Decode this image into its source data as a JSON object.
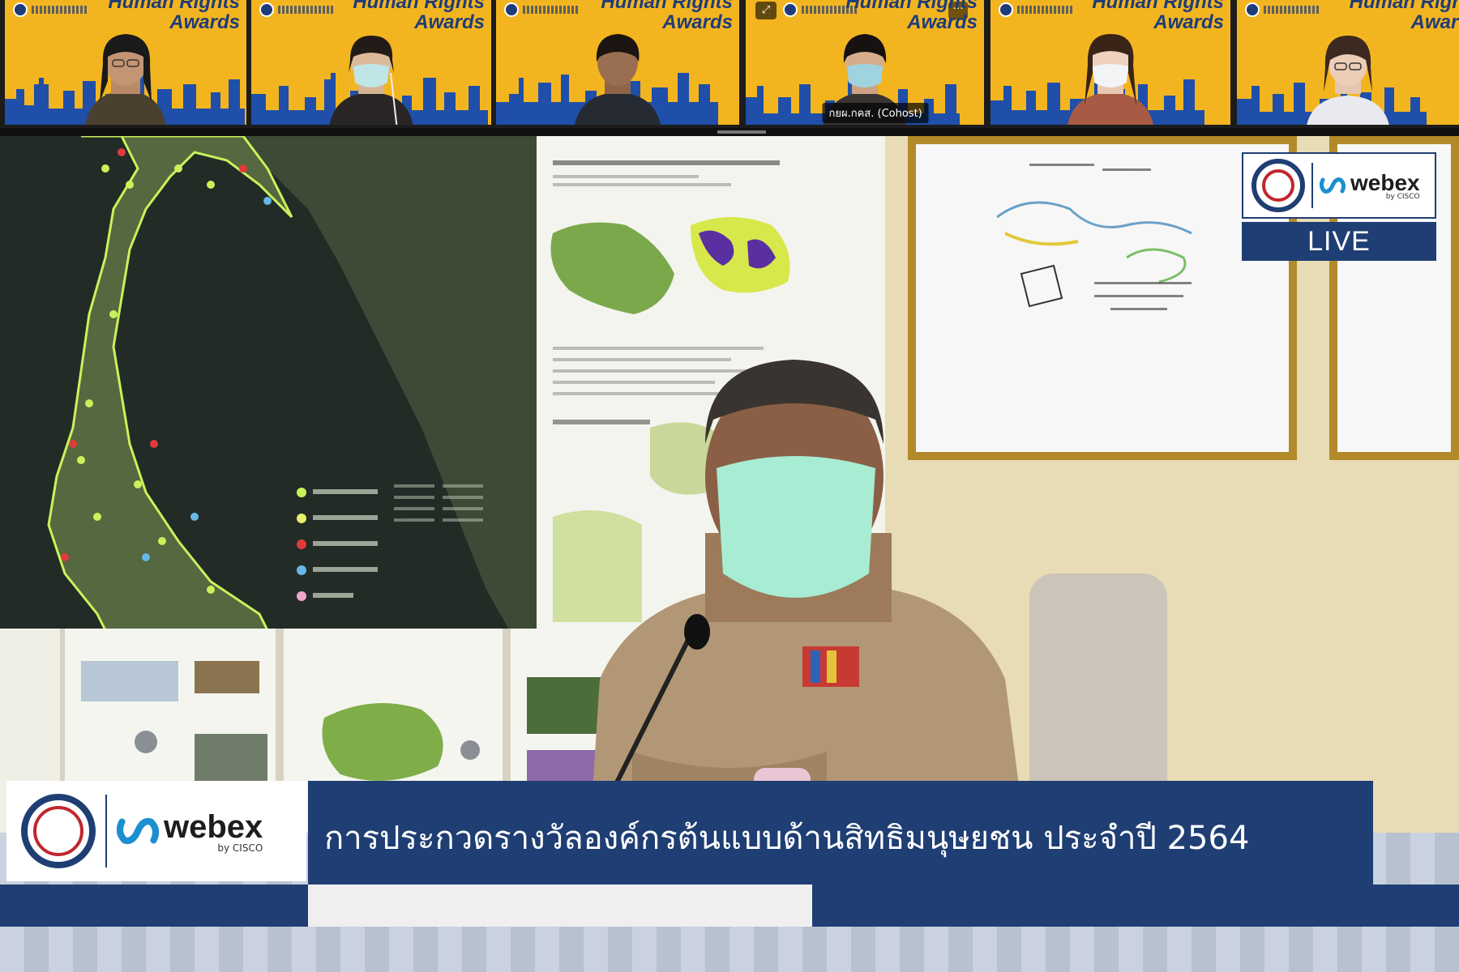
{
  "participants": [
    {
      "title_line1": "Human Rights",
      "title_line2": "Awards",
      "caption": ""
    },
    {
      "title_line1": "Human Rights",
      "title_line2": "Awards",
      "caption": ""
    },
    {
      "title_line1": "Human Rights",
      "title_line2": "Awards",
      "caption": ""
    },
    {
      "title_line1": "Human Rights",
      "title_line2": "Awards",
      "caption": "กยผ.กคส. (Cohost)"
    },
    {
      "title_line1": "Human Rights",
      "title_line2": "Awards",
      "caption": ""
    },
    {
      "title_line1": "Human Right",
      "title_line2": "Award",
      "caption": ""
    }
  ],
  "tile_controls": {
    "more": "···",
    "expand": "⤢"
  },
  "live_badge": {
    "brand": "webex",
    "by": "by CISCO",
    "status": "LIVE"
  },
  "lower_third": {
    "brand": "webex",
    "by": "by CISCO",
    "title": "การประกวดรางวัลองค์กรต้นแบบด้านสิทธิมนุษยชน ประจำปี 2564",
    "subtitle": ""
  },
  "colors": {
    "brand_blue": "#1f3e73",
    "banner_yellow": "#f3b51f",
    "seal_red": "#c0272d"
  }
}
